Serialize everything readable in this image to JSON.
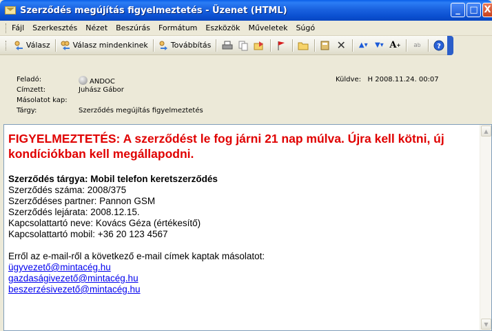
{
  "window": {
    "title": "Szerződés megújítás figyelmeztetés - Üzenet (HTML)",
    "minimize": "_",
    "maximize": "□",
    "close": "X"
  },
  "menu": [
    "Fájl",
    "Szerkesztés",
    "Nézet",
    "Beszúrás",
    "Formátum",
    "Eszközök",
    "Műveletek",
    "Súgó"
  ],
  "toolbar": {
    "reply": "Válasz",
    "reply_all": "Válasz mindenkinek",
    "forward": "Továbbítás"
  },
  "header": {
    "from_label": "Feladó:",
    "from_value": "ANDOC",
    "to_label": "Címzett:",
    "to_value": "Juhász Gábor",
    "cc_label": "Másolatot kap:",
    "cc_value": "",
    "subject_label": "Tárgy:",
    "subject_value": "Szerződés megújítás figyelmeztetés",
    "sent_label": "Küldve:",
    "sent_value": "H 2008.11.24. 00:07"
  },
  "body": {
    "warning": "FIGYELMEZTETÉS: A szerződést le fog járni 21 nap múlva. Újra kell kötni, új kondíciókban kell megállapodni.",
    "subject_line": "Szerződés tárgya: Mobil telefon keretszerződés",
    "details": [
      "Szerződés száma: 2008/375",
      "Szerződéses partner: Pannon GSM",
      "Szerződés lejárata: 2008.12.15.",
      "Kapcsolattartó neve: Kovács Géza (értékesítő)",
      "Kapcsolattartó mobil: +36 20 123 4567"
    ],
    "cc_intro": "Erről az e-mail-ről a következő e-mail címek kaptak másolatot:",
    "cc_links": [
      "ügyvezető@mintacég.hu",
      "gazdaságivezető@mintacég.hu",
      "beszerzésivezető@mintacég.hu"
    ]
  },
  "colors": {
    "warning": "#e00000",
    "link": "#0000ee",
    "titlebar": "#0a4fd0"
  }
}
